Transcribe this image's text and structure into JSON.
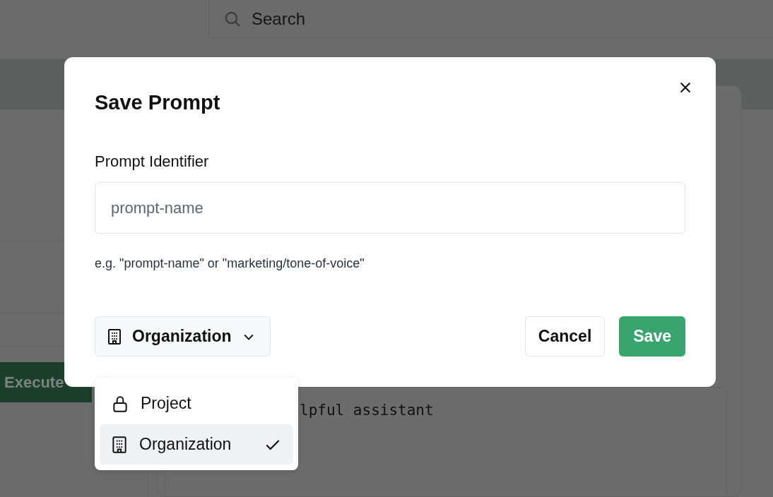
{
  "background": {
    "search": {
      "placeholder": "Search"
    },
    "execute_button": "Execute",
    "editor_text": "lpful assistant"
  },
  "dialog": {
    "title": "Save Prompt",
    "field_label": "Prompt Identifier",
    "input": {
      "placeholder": "prompt-name"
    },
    "hint": "e.g. \"prompt-name\" or \"marketing/tone-of-voice\"",
    "scope": {
      "label": "Organization",
      "kind": "organization",
      "expanded": true
    },
    "buttons": [
      {
        "label": "Cancel",
        "kind": "secondary"
      },
      {
        "label": "Save",
        "kind": "primary"
      }
    ]
  },
  "scope_menu": [
    {
      "label": "Project",
      "kind": "project",
      "selected": false
    },
    {
      "label": "Organization",
      "kind": "organization",
      "selected": true
    }
  ]
}
